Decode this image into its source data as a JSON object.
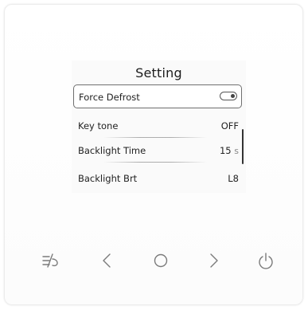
{
  "screen": {
    "title": "Setting",
    "items": [
      {
        "label": "Force Defrost",
        "control": "toggle",
        "toggle_state": "on"
      },
      {
        "label": "Key tone",
        "value": "OFF"
      },
      {
        "label": "Backlight Time",
        "value": "15",
        "unit": "s"
      },
      {
        "label": "Backlight Brt",
        "value": "L8"
      }
    ]
  },
  "buttons": [
    {
      "name": "mode-button",
      "icon": "defrost-mode-icon"
    },
    {
      "name": "left-button",
      "icon": "chevron-left-icon"
    },
    {
      "name": "ok-button",
      "icon": "circle-icon"
    },
    {
      "name": "right-button",
      "icon": "chevron-right-icon"
    },
    {
      "name": "power-button",
      "icon": "power-icon"
    }
  ],
  "colors": {
    "panel": "#ffffff",
    "screen": "#fafafa",
    "text": "#222222",
    "icon": "#7a7a7a"
  }
}
